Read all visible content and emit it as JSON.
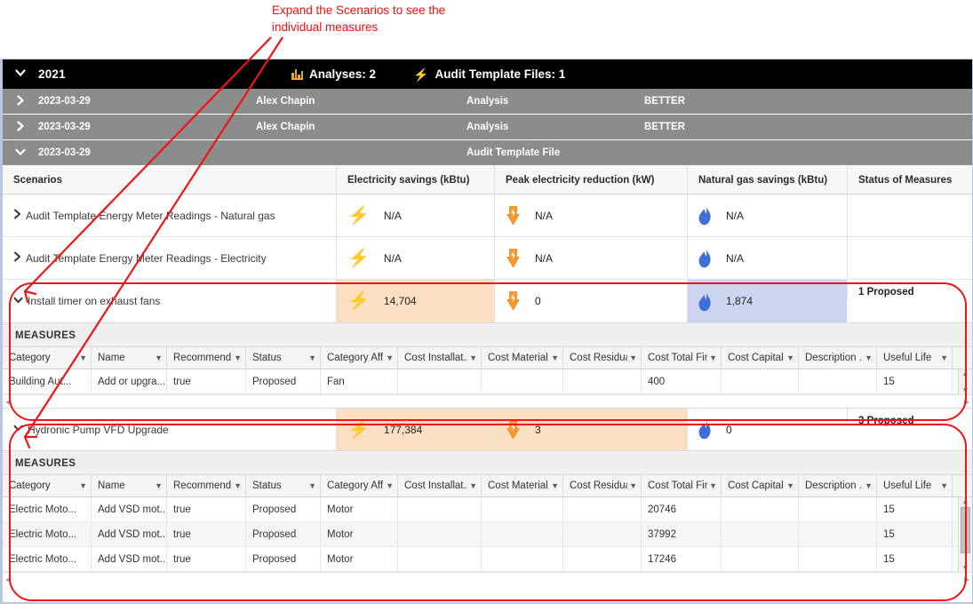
{
  "annotation": {
    "text": "Expand the Scenarios to see the\nindividual measures",
    "color": "#fb0b0b"
  },
  "year_bar": {
    "chevron": "❯",
    "year": "2021",
    "analyses_icon": "bar-chart-icon",
    "analyses_label": "Analyses: 2",
    "audit_icon": "lightning-bolt-icon",
    "audit_label": "Audit Template Files: 1"
  },
  "analysis_rows": [
    {
      "chevron": "❯",
      "date": "2023-03-29",
      "user": "Alex Chapin",
      "type": "Analysis",
      "flag": "BETTER"
    },
    {
      "chevron": "❯",
      "date": "2023-03-29",
      "user": "Alex Chapin",
      "type": "Analysis",
      "flag": "BETTER"
    },
    {
      "chevron": "❯",
      "date": "2023-03-29",
      "user": "",
      "type": "Audit Template File",
      "flag": ""
    }
  ],
  "scenario_table": {
    "headers": [
      "Scenarios",
      "Electricity savings (kBtu)",
      "Peak electricity reduction (kW)",
      "Natural gas savings (kBtu)",
      "Status of Measures"
    ],
    "rows": [
      {
        "name": "Audit Template Energy Meter Readings - Natural gas",
        "twisty": "❯",
        "electricity": "N/A",
        "peak": "N/A",
        "gas": "N/A",
        "status": "",
        "electricity_fill": "none",
        "peak_fill": "none",
        "gas_fill": "none",
        "expanded": false
      },
      {
        "name": "Audit Template Energy Meter Readings - Electricity",
        "twisty": "❯",
        "electricity": "N/A",
        "peak": "N/A",
        "gas": "N/A",
        "status": "",
        "electricity_fill": "none",
        "peak_fill": "none",
        "gas_fill": "none",
        "expanded": false
      },
      {
        "name": "Install timer on exhaust fans",
        "twisty": "∨",
        "electricity": "14,704",
        "peak": "0",
        "gas": "1,874",
        "status": "1 Proposed",
        "electricity_fill": "#fbdfc2",
        "peak_fill": "#ffffff",
        "gas_fill": "#ccd4ef",
        "expanded": true
      },
      {
        "name": "Hydronic Pump VFD Upgrade",
        "twisty": "∨",
        "electricity": "177,384",
        "peak": "3",
        "gas": "0",
        "status": "3 Proposed",
        "electricity_fill": "#fbdfc2",
        "peak_fill": "#fbdfc2",
        "gas_fill": "#ffffff",
        "expanded": true
      }
    ]
  },
  "measures_panels": [
    {
      "title": "MEASURES",
      "columns": [
        "Category",
        "Name",
        "Recommend..",
        "Status",
        "Category Aff..",
        "Cost Installat..",
        "Cost Material..",
        "Cost Residua..",
        "Cost Total Fir..",
        "Cost Capital",
        "Description ..",
        "Useful Life"
      ],
      "rows": [
        [
          "Building Aut...",
          "Add or upgra...",
          "true",
          "Proposed",
          "Fan",
          "",
          "",
          "",
          "400",
          "",
          "",
          "15"
        ]
      ]
    },
    {
      "title": "MEASURES",
      "columns": [
        "Category",
        "Name",
        "Recommend..",
        "Status",
        "Category Aff..",
        "Cost Installat..",
        "Cost Material..",
        "Cost Residua..",
        "Cost Total Fir..",
        "Cost Capital",
        "Description ..",
        "Useful Life"
      ],
      "rows": [
        [
          "Electric Moto...",
          "Add VSD mot...",
          "true",
          "Proposed",
          "Motor",
          "",
          "",
          "",
          "20746",
          "",
          "",
          "15"
        ],
        [
          "Electric Moto...",
          "Add VSD mot...",
          "true",
          "Proposed",
          "Motor",
          "",
          "",
          "",
          "37992",
          "",
          "",
          "15"
        ],
        [
          "Electric Moto...",
          "Add VSD mot...",
          "true",
          "Proposed",
          "Motor",
          "",
          "",
          "",
          "17246",
          "",
          "",
          "15"
        ]
      ]
    }
  ],
  "colors": {
    "accent_orange": "#f2982f",
    "accent_blue": "#3f6fd8",
    "callout_red": "#ef1515",
    "header_black": "#000000",
    "row_gray": "#8c8c8c"
  }
}
